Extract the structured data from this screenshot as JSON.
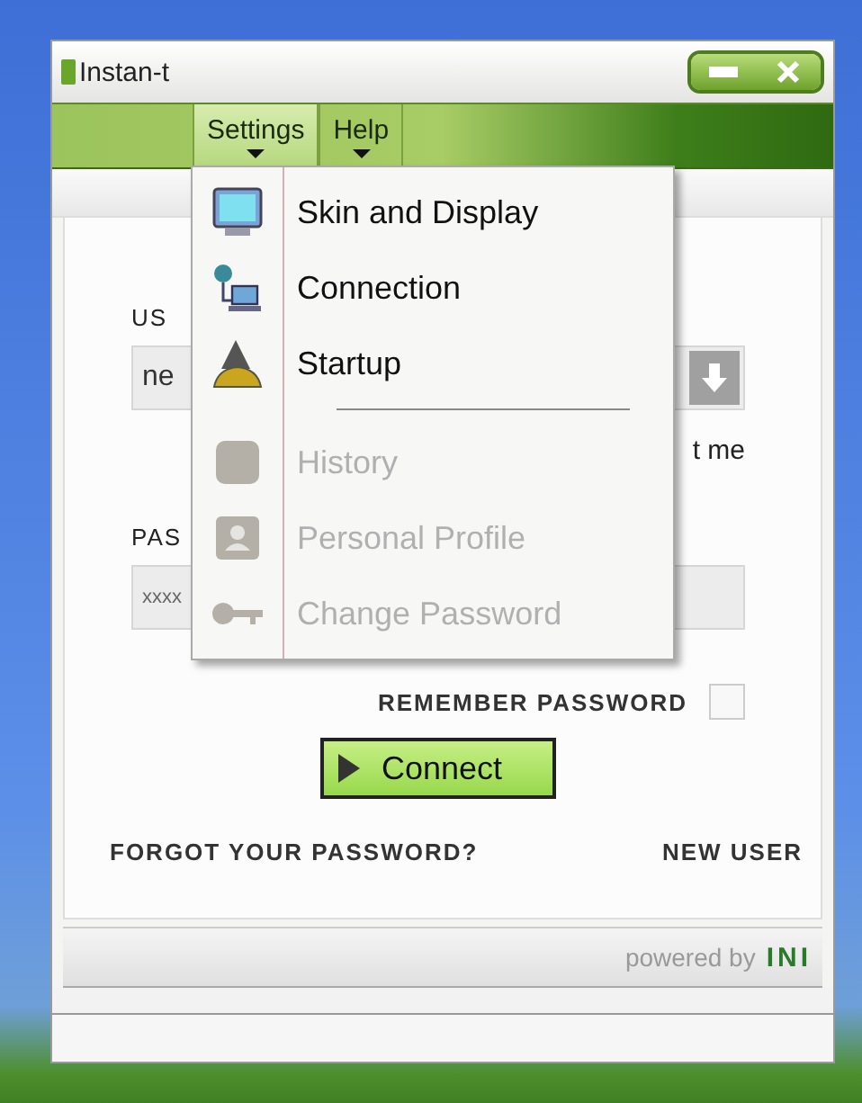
{
  "window": {
    "title": "Instan-t"
  },
  "menu_bar": [
    {
      "label": "Settings",
      "selected": true
    },
    {
      "label": "Help",
      "selected": false
    }
  ],
  "settings_menu": [
    {
      "kind": "item",
      "label": "Skin and Display",
      "disabled": false
    },
    {
      "kind": "item",
      "label": "Connection",
      "disabled": false
    },
    {
      "kind": "item",
      "label": "Startup",
      "disabled": false
    },
    {
      "kind": "separator"
    },
    {
      "kind": "item",
      "label": "History",
      "disabled": true
    },
    {
      "kind": "item",
      "label": "Personal Profile",
      "disabled": true
    },
    {
      "kind": "item",
      "label": "Change Password",
      "disabled": true
    }
  ],
  "login_form": {
    "username_label": "US",
    "username_value": "ne",
    "remember_me_label": "t me",
    "password_label": "PAS",
    "password_value": "xxxx",
    "remember_password_label": "REMEMBER PASSWORD",
    "remember_password_checked": false,
    "connect_button": "Connect",
    "forgot_password_link": "FORGOT YOUR PASSWORD?",
    "new_user_link": "NEW USER"
  },
  "footer": {
    "powered_by": "powered by",
    "logo": "INI"
  }
}
